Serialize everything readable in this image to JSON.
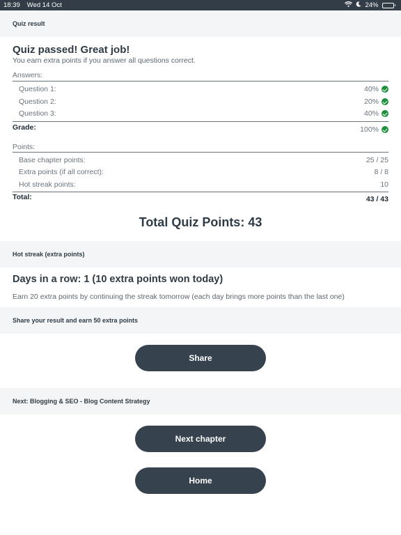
{
  "status": {
    "time": "18:39",
    "date": "Wed 14 Oct",
    "battery": "24%",
    "battery_level": 0.24
  },
  "quiz": {
    "section_label": "Quiz result",
    "heading": "Quiz passed! Great job!",
    "subheading": "You earn extra points if you answer all questions correct.",
    "answers_label": "Answers:",
    "answers": [
      {
        "label": "Question 1:",
        "value": "40%"
      },
      {
        "label": "Question 2:",
        "value": "20%"
      },
      {
        "label": "Question 3:",
        "value": "40%"
      }
    ],
    "grade_label": "Grade:",
    "grade_value": "100%",
    "points_label": "Points:",
    "points": [
      {
        "label": "Base chapter points:",
        "value": "25 / 25"
      },
      {
        "label": "Extra points (if all correct):",
        "value": "8 / 8"
      },
      {
        "label": "Hot streak points:",
        "value": "10"
      }
    ],
    "total_label": "Total:",
    "total_value": "43 / 43",
    "total_quiz_points": "Total Quiz Points: 43"
  },
  "streak": {
    "section_label": "Hot streak (extra points)",
    "heading": "Days in a row: 1 (10 extra points won today)",
    "description": "Earn 20 extra points by continuing the streak tomorrow (each day brings more points than the last one)"
  },
  "share": {
    "section_label": "Share your result and earn 50 extra points",
    "button_label": "Share"
  },
  "next": {
    "section_label": "Next: Blogging & SEO - Blog Content Strategy",
    "next_button_label": "Next chapter",
    "home_button_label": "Home"
  },
  "icons": {
    "answer_ok": "check-circle-icon",
    "wifi": "wifi-icon",
    "moon": "moon-icon",
    "battery": "battery-icon"
  },
  "colors": {
    "status_bar": "#323d47",
    "button": "#36434e",
    "check": "#1e8f3a",
    "section_bg": "#f4f5f6"
  }
}
